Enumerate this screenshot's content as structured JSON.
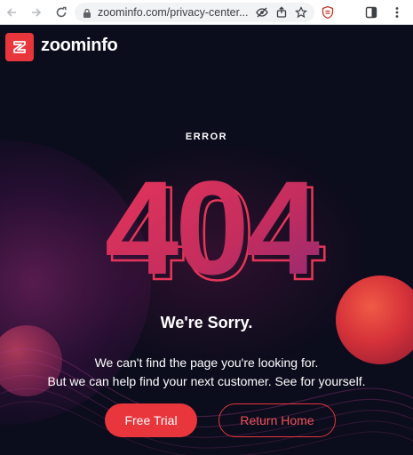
{
  "browser": {
    "url": "zoominfo.com/privacy-center..."
  },
  "header": {
    "brand": "zoominfo"
  },
  "main": {
    "error_label": "ERROR",
    "code": "404",
    "heading": "We're Sorry.",
    "message_line1": "We can't find the page you're looking for.",
    "message_line2": "But we can help find your next customer. See for yourself.",
    "primary_button": "Free Trial",
    "secondary_button": "Return Home"
  },
  "colors": {
    "accent": "#e8363c",
    "background": "#0b0c1c"
  }
}
